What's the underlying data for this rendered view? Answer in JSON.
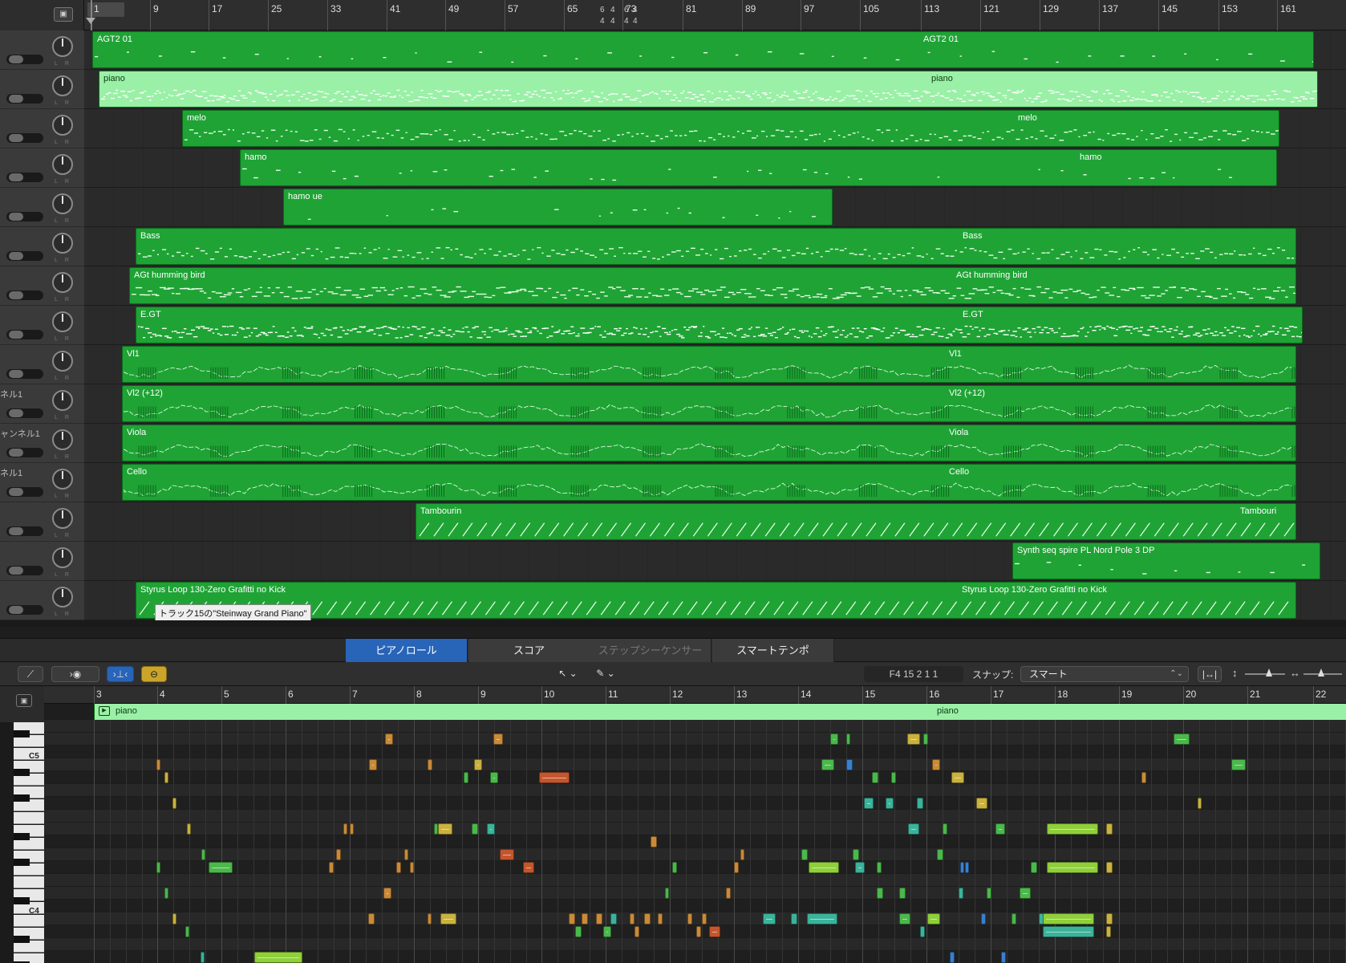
{
  "arrange": {
    "bar_numbers": [
      "1",
      "9",
      "17",
      "25",
      "33",
      "41",
      "49",
      "57",
      "65",
      "73",
      "81",
      "89",
      "97",
      "105",
      "113",
      "121",
      "129",
      "137",
      "145",
      "153",
      "161"
    ],
    "time_signatures": [
      "6\n4",
      "4\n4",
      "6\n4",
      "4\n4"
    ],
    "header_button_icon": "▣",
    "tracks": [
      {
        "name": "",
        "regions": [
          {
            "label": "AGT2 01",
            "label2": "AGT2 01",
            "style": "dark"
          }
        ]
      },
      {
        "name": "",
        "regions": [
          {
            "label": "piano",
            "label2": "piano",
            "style": "light"
          }
        ]
      },
      {
        "name": "",
        "regions": [
          {
            "label": "melo",
            "label2": "melo",
            "style": "dark"
          }
        ]
      },
      {
        "name": "",
        "regions": [
          {
            "label": "hamo",
            "label2": "hamo",
            "style": "dark"
          }
        ]
      },
      {
        "name": "",
        "regions": [
          {
            "label": "hamo ue",
            "label2": "",
            "style": "dark"
          }
        ]
      },
      {
        "name": "",
        "regions": [
          {
            "label": "Bass",
            "label2": "Bass",
            "style": "dark"
          }
        ]
      },
      {
        "name": "",
        "regions": [
          {
            "label": "AGt humming bird",
            "label2": "AGt humming bird",
            "style": "dark"
          }
        ]
      },
      {
        "name": "",
        "regions": [
          {
            "label": "E.GT",
            "label2": "E.GT",
            "style": "dark"
          }
        ]
      },
      {
        "name": "",
        "regions": [
          {
            "label": "Vl1",
            "label2": "Vl1",
            "style": "dark"
          }
        ]
      },
      {
        "name": "ネル1",
        "regions": [
          {
            "label": "Vl2 (+12)",
            "label2": "Vl2 (+12)",
            "style": "dark"
          }
        ]
      },
      {
        "name": "ャンネル1",
        "regions": [
          {
            "label": "Viola",
            "label2": "Viola",
            "style": "dark"
          }
        ]
      },
      {
        "name": "ネル1",
        "regions": [
          {
            "label": "Cello",
            "label2": "Cello",
            "style": "dark"
          }
        ]
      },
      {
        "name": "",
        "regions": [
          {
            "label": "Tambourin",
            "label2": "Tambouri",
            "style": "dark"
          }
        ]
      },
      {
        "name": "",
        "regions": [
          {
            "label": "Synth seq spire PL Nord Pole 3 DP",
            "label2": "",
            "style": "dark"
          }
        ]
      },
      {
        "name": "",
        "regions": [
          {
            "label": "Styrus Loop 130-Zero Grafitti no Kick",
            "label2": "Styrus Loop 130-Zero Grafitti no Kick",
            "style": "dark"
          }
        ]
      }
    ],
    "tooltip": "トラック15の\"Steinway Grand Piano\""
  },
  "editor": {
    "tabs": [
      {
        "label": "ピアノロール",
        "state": "active"
      },
      {
        "label": "スコア",
        "state": "normal"
      },
      {
        "label": "ステップシーケンサー",
        "state": "disabled"
      },
      {
        "label": "スマートテンポ",
        "state": "normal"
      }
    ],
    "toolbar": {
      "position": "F4   15 2 1 1",
      "snap_label": "スナップ:",
      "snap_value": "スマート",
      "snap_arrows": "⌃⌄",
      "icons": {
        "automation": "⟋",
        "midi_in": "›◉",
        "collapse": "›⊥‹",
        "link": "⊖",
        "pointer": "↖ ⌄",
        "pencil": "✎ ⌄",
        "fit": "|↔|",
        "vzoom": "↕",
        "hzoom": "↔"
      }
    },
    "corner_icon": "▣",
    "region_label_left": "piano",
    "region_label_right": "piano",
    "region_icon": "▶",
    "bar_numbers": [
      "3",
      "4",
      "5",
      "6",
      "7",
      "8",
      "9",
      "10",
      "11",
      "12",
      "13",
      "14",
      "15",
      "16",
      "17",
      "18",
      "19",
      "20",
      "21",
      "22"
    ],
    "key_labels": [
      "C5",
      "C4"
    ],
    "note_colors": {
      "orange": "#c98a3a",
      "red": "#c4562e",
      "yellow": "#c9b23e",
      "green": "#4bb84b",
      "lime": "#8fcf3a",
      "teal": "#3bb39a",
      "blue": "#3a7fd0"
    }
  }
}
